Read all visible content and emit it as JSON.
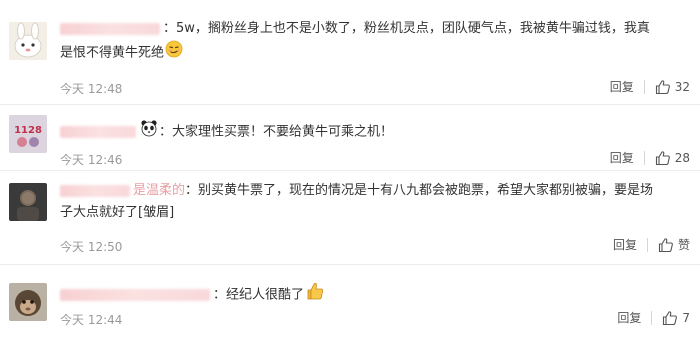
{
  "actions": {
    "reply_label": "回复"
  },
  "comments": [
    {
      "separator": "：",
      "text": "5w，搁粉丝身上也不是小数了，粉丝机灵点，团队硬气点，我被黄牛骗过钱，我真是恨不得黄牛死绝",
      "emoji": "smirk-face-emoji",
      "time": "今天 12:48",
      "likes": "32"
    },
    {
      "separator": "：",
      "text": "大家理性买票！不要给黄牛可乘之机！",
      "emoji": "panda-face-emoji",
      "time": "今天 12:46",
      "likes": "28"
    },
    {
      "name_suffix": "是温柔的",
      "separator": "：",
      "text": "别买黄牛票了，现在的情况是十有八九都会被跑票，希望大家都别被骗，要是场子大点就好了[皱眉]",
      "time": "今天 12:50",
      "likes": "赞"
    },
    {
      "separator": "：",
      "text": "经纪人很酷了",
      "emoji": "thumbs-up-emoji",
      "time": "今天 12:44",
      "likes": "7"
    }
  ],
  "colors": {
    "text": "#333333",
    "meta": "#9a9a9a",
    "divider": "#ececec",
    "blurred_username": "#f0aaaf"
  }
}
